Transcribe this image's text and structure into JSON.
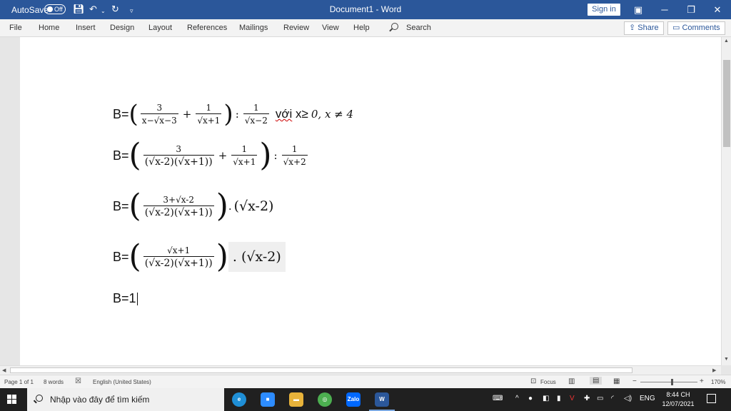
{
  "titlebar": {
    "autosave_label": "AutoSave",
    "autosave_state": "Off",
    "document_title": "Document1  -  Word",
    "signin_label": "Sign in",
    "icons": [
      "save-icon",
      "undo-icon",
      "redo-icon",
      "customize-qat-icon",
      "ribbon-display-icon",
      "minimize-icon",
      "restore-icon",
      "close-icon"
    ]
  },
  "ribbon": {
    "tabs": [
      "File",
      "Home",
      "Insert",
      "Design",
      "Layout",
      "References",
      "Mailings",
      "Review",
      "View",
      "Help"
    ],
    "search_label": "Search",
    "share_label": "Share",
    "comments_label": "Comments"
  },
  "document": {
    "line1": {
      "b": "B=",
      "f1_num": "3",
      "f1_den": "x−√x−3",
      "plus": "+",
      "f2_num": "1",
      "f2_den": "√x+1",
      "colon": ":",
      "f3_num": "1",
      "f3_den": "√x−2",
      "voi": "với",
      "cond": "x≥",
      "cond_math": "0, x ≠ 4"
    },
    "line2": {
      "b": "B=",
      "f1_num": "3",
      "f1_den": "(√x-2)(√x+1))",
      "plus": "+",
      "f2_num": "1",
      "f2_den": "√x+1",
      "colon": ":",
      "f3_num": "1",
      "f3_den": "√x+2"
    },
    "line3": {
      "b": "B=",
      "f1_num": "3+√x-2",
      "f1_den": "(√x-2)(√x+1))",
      "dot": ".",
      "tail": "(√x-2)"
    },
    "line4": {
      "b": "B=",
      "f1_num": "√x+1",
      "f1_den": "(√x-2)(√x+1))",
      "dot": ".",
      "tail": "(√x-2)"
    },
    "line5": "B=1"
  },
  "statusbar": {
    "page": "Page 1 of 1",
    "words": "8 words",
    "language": "English (United States)",
    "focus": "Focus",
    "zoom": "170%",
    "zoom_minus": "−",
    "zoom_plus": "+"
  },
  "taskbar": {
    "search_placeholder": "Nhập vào đây để tìm kiếm",
    "apps": [
      {
        "name": "edge",
        "label": "e",
        "color": "#1f8fd6"
      },
      {
        "name": "zoom-meetings",
        "label": "■",
        "color": "#2d8cff"
      },
      {
        "name": "file-explorer",
        "label": "▬",
        "color": "#e8b33a"
      },
      {
        "name": "chrome-like",
        "label": "◎",
        "color": "#4caf50"
      },
      {
        "name": "zalo",
        "label": "Zalo",
        "color": "#0068ff"
      },
      {
        "name": "word",
        "label": "W",
        "color": "#2b579a"
      }
    ],
    "lang": "ENG",
    "time": "8:44 CH",
    "date": "12/07/2021"
  }
}
